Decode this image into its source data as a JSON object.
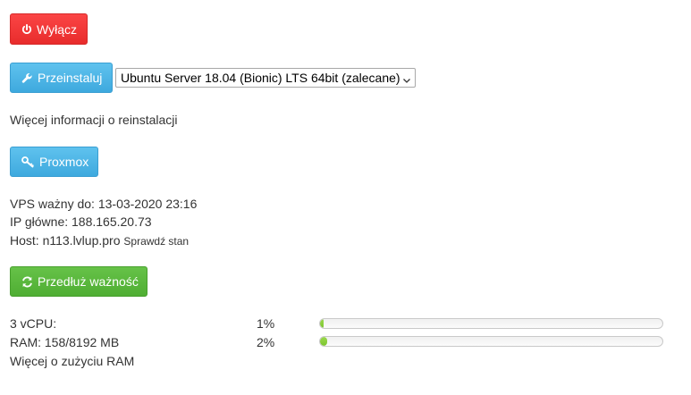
{
  "shutdown": {
    "label": "Wyłącz",
    "color": "#f03a3a"
  },
  "reinstall": {
    "button_label": "Przeinstaluj",
    "selected_os": "Ubuntu Server 18.04 (Bionic) LTS 64bit (zalecane)",
    "more_info_link": "Więcej informacji o reinstalacji"
  },
  "proxmox": {
    "label": "Proxmox"
  },
  "vps_info": {
    "valid_until_label": "VPS ważny do:",
    "valid_until": "13-03-2020 23:16",
    "ip_label": "IP główne:",
    "ip": "188.165.20.73",
    "host_label": "Host:",
    "host": "n113.lvlup.pro",
    "check_status": "Sprawdź stan"
  },
  "extend": {
    "label": "Przedłuż ważność",
    "color": "#56b33a"
  },
  "usage": {
    "cpu": {
      "label": "3 vCPU:",
      "percent_text": "1%",
      "fraction": 0.01
    },
    "ram": {
      "label": "RAM: 158/8192 MB",
      "percent_text": "2%",
      "fraction": 0.02
    },
    "more_link": "Więcej o zużyciu RAM"
  },
  "icons": {
    "shutdown": "power-icon",
    "reinstall": "wrench-icon",
    "proxmox": "key-icon",
    "extend": "refresh-icon"
  },
  "colors": {
    "primary": "#45afe2",
    "progress": "#86cc3a"
  }
}
